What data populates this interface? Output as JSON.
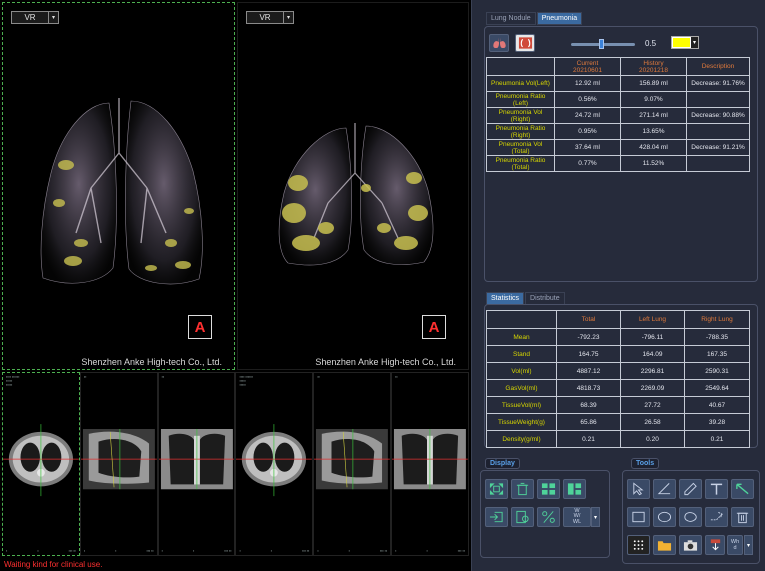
{
  "viewer": {
    "vr_left_label": "VR",
    "vr_right_label": "VR",
    "orientation_left": "A",
    "orientation_right": "A",
    "company_left": "Shenzhen Anke High-tech Co., Ltd.",
    "company_right": "Shenzhen Anke High-tech Co., Ltd.",
    "mpr_views": [
      "axial",
      "sagittal",
      "coronal",
      "axial",
      "sagittal",
      "coronal"
    ],
    "status_text": "Waiting kind for clinical use."
  },
  "panel": {
    "top_tabs": [
      "Lung Nodule",
      "Pneumonia"
    ],
    "slider_value": "0.5",
    "highlight_color": "#ffff00",
    "pneumonia_table": {
      "headers": [
        "",
        "Current\n20210601",
        "History\n20201218",
        "Description"
      ],
      "rows": [
        {
          "label": "Pneumonia Vol(Left)",
          "current": "12.92 ml",
          "history": "156.89 ml",
          "desc": "Decrease: 91.76%"
        },
        {
          "label": "Pneumonia Ratio\n(Left)",
          "current": "0.56%",
          "history": "9.07%",
          "desc": ""
        },
        {
          "label": "Pneumonia Vol\n(Right)",
          "current": "24.72 ml",
          "history": "271.14 ml",
          "desc": "Decrease: 90.88%"
        },
        {
          "label": "Pneumonia Ratio\n(Right)",
          "current": "0.95%",
          "history": "13.65%",
          "desc": ""
        },
        {
          "label": "Pneumonia Vol\n(Total)",
          "current": "37.64 ml",
          "history": "428.04 ml",
          "desc": "Decrease: 91.21%"
        },
        {
          "label": "Pneumonia Ratio\n(Total)",
          "current": "0.77%",
          "history": "11.52%",
          "desc": ""
        }
      ]
    },
    "stats_tabs": [
      "Statistics",
      "Distribute"
    ],
    "stats_table": {
      "headers": [
        "",
        "Total",
        "Left Lung",
        "Right Lung"
      ],
      "rows": [
        {
          "label": "Mean",
          "total": "-792.23",
          "left": "-796.11",
          "right": "-788.35"
        },
        {
          "label": "Stand",
          "total": "164.75",
          "left": "164.09",
          "right": "167.35"
        },
        {
          "label": "Vol(ml)",
          "total": "4887.12",
          "left": "2296.81",
          "right": "2590.31"
        },
        {
          "label": "GasVol(ml)",
          "total": "4818.73",
          "left": "2269.09",
          "right": "2549.64"
        },
        {
          "label": "TissueVol(ml)",
          "total": "68.39",
          "left": "27.72",
          "right": "40.67"
        },
        {
          "label": "TissueWeight(g)",
          "total": "65.86",
          "left": "26.58",
          "right": "39.28"
        },
        {
          "label": "Density(g/ml)",
          "total": "0.21",
          "left": "0.20",
          "right": "0.21"
        }
      ]
    },
    "display_title": "Display",
    "tools_title": "Tools",
    "ww_label": "W\nW/\nWL",
    "wh_label": "Wh\nd"
  }
}
